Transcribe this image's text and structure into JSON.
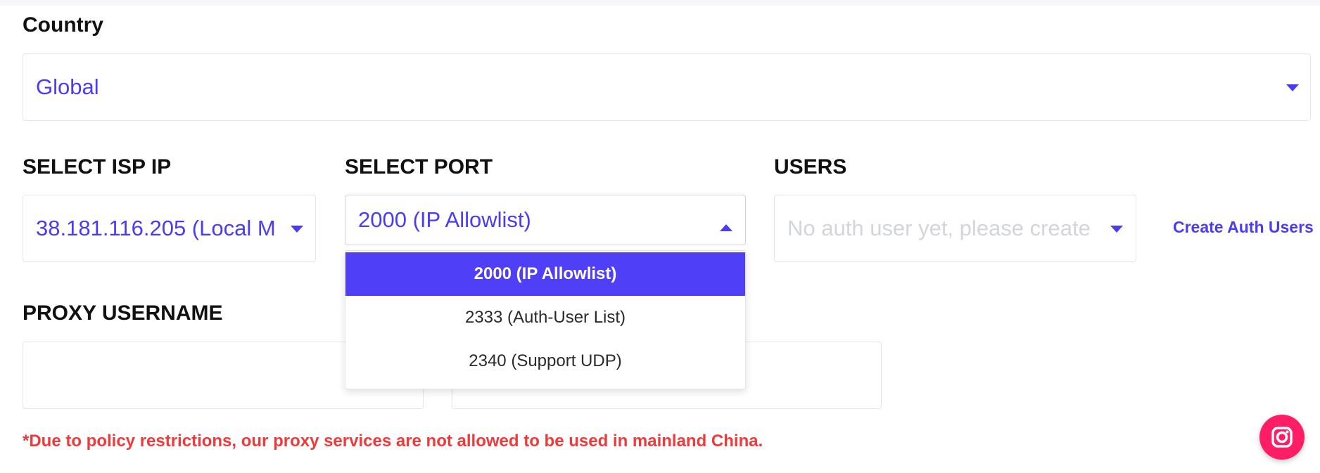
{
  "country": {
    "label": "Country",
    "value": "Global"
  },
  "isp_ip": {
    "label": "SELECT ISP IP",
    "value": "38.181.116.205 (Local M"
  },
  "port": {
    "label": "SELECT PORT",
    "value": "2000 (IP Allowlist)",
    "options": [
      "2000 (IP Allowlist)",
      "2333 (Auth-User List)",
      "2340 (Support UDP)"
    ]
  },
  "users": {
    "label": "USERS",
    "placeholder": "No auth user yet, please create",
    "create_link": "Create Auth Users"
  },
  "proxy_username": {
    "label": "PROXY USERNAME",
    "value": ""
  },
  "notice": "*Due to policy restrictions, our proxy services are not allowed to be used in mainland China.",
  "icons": {
    "caret": "chevron-down-icon",
    "fab": "instagram-icon"
  },
  "colors": {
    "accent": "#4a3cf4",
    "selected_option_bg": "#4f3ff6",
    "notice": "#ee3a3a",
    "fab": "#ff1e65",
    "placeholder": "#d3d5da"
  }
}
